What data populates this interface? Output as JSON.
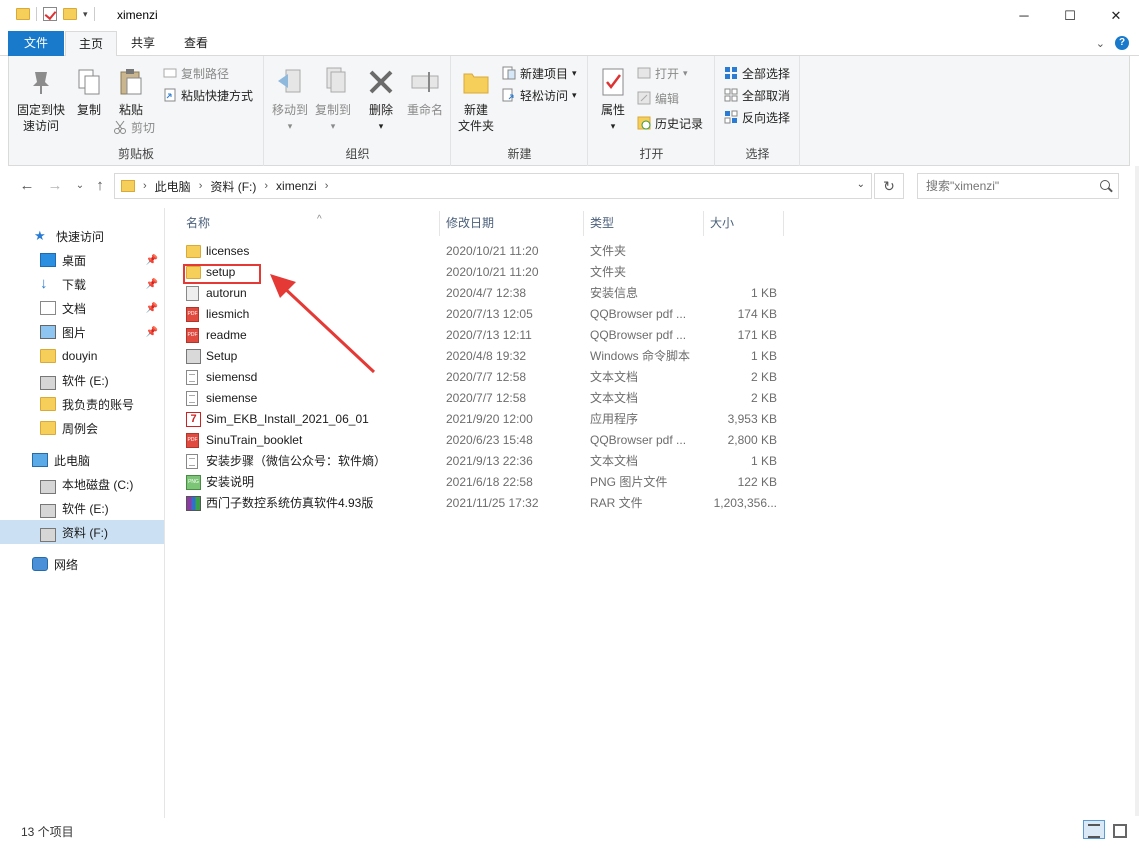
{
  "window": {
    "title": "ximenzi",
    "minimize": "─",
    "maximize": "☐",
    "close": "✕"
  },
  "ribbon_tabs": {
    "file": "文件",
    "home": "主页",
    "share": "共享",
    "view": "查看"
  },
  "ribbon": {
    "clipboard": {
      "label": "剪贴板",
      "pin": "固定到快速访问",
      "pin_line1": "固定到快",
      "pin_line2": "速访问",
      "copy": "复制",
      "paste": "粘贴",
      "copy_path": "复制路径",
      "paste_shortcut": "粘贴快捷方式",
      "cut": "剪切"
    },
    "organize": {
      "label": "组织",
      "move_to": "移动到",
      "copy_to": "复制到",
      "delete": "删除",
      "rename": "重命名"
    },
    "new": {
      "label": "新建",
      "new_folder_line1": "新建",
      "new_folder_line2": "文件夹",
      "new_item": "新建项目",
      "easy_access": "轻松访问"
    },
    "open": {
      "label": "打开",
      "properties": "属性",
      "open": "打开",
      "edit": "编辑",
      "history": "历史记录"
    },
    "select": {
      "label": "选择",
      "select_all": "全部选择",
      "select_none": "全部取消",
      "invert": "反向选择"
    }
  },
  "address": {
    "crumbs": [
      "此电脑",
      "资料 (F:)",
      "ximenzi"
    ],
    "search_placeholder": "搜索\"ximenzi\""
  },
  "nav_pane": {
    "items": [
      {
        "label": "快速访问",
        "icon": "star-icon",
        "pinned": false
      },
      {
        "label": "桌面",
        "icon": "desktop-icon",
        "pinned": true
      },
      {
        "label": "下载",
        "icon": "download-icon",
        "pinned": true
      },
      {
        "label": "文档",
        "icon": "document-icon",
        "pinned": true
      },
      {
        "label": "图片",
        "icon": "picture-icon",
        "pinned": true
      },
      {
        "label": "douyin",
        "icon": "folder-icon",
        "pinned": false
      },
      {
        "label": "软件 (E:)",
        "icon": "drive-icon",
        "pinned": false
      },
      {
        "label": "我负责的账号",
        "icon": "folder-icon",
        "pinned": false
      },
      {
        "label": "周例会",
        "icon": "folder-icon",
        "pinned": false
      },
      {
        "label": "此电脑",
        "icon": "pc-icon",
        "pinned": false
      },
      {
        "label": "本地磁盘 (C:)",
        "icon": "drive-icon",
        "pinned": false
      },
      {
        "label": "软件 (E:)",
        "icon": "drive-icon",
        "pinned": false
      },
      {
        "label": "资料 (F:)",
        "icon": "drive-icon",
        "pinned": false,
        "selected": true
      },
      {
        "label": "网络",
        "icon": "network-icon",
        "pinned": false
      }
    ]
  },
  "columns": {
    "name": "名称",
    "date": "修改日期",
    "type": "类型",
    "size": "大小"
  },
  "files": [
    {
      "name": "licenses",
      "date": "2020/10/21 11:20",
      "type": "文件夹",
      "size": "",
      "icon": "folder"
    },
    {
      "name": "setup",
      "date": "2020/10/21 11:20",
      "type": "文件夹",
      "size": "",
      "icon": "folder"
    },
    {
      "name": "autorun",
      "date": "2020/4/7 12:38",
      "type": "安装信息",
      "size": "1 KB",
      "icon": "inf"
    },
    {
      "name": "liesmich",
      "date": "2020/7/13 12:05",
      "type": "QQBrowser pdf ...",
      "size": "174 KB",
      "icon": "pdf"
    },
    {
      "name": "readme",
      "date": "2020/7/13 12:11",
      "type": "QQBrowser pdf ...",
      "size": "171 KB",
      "icon": "pdf"
    },
    {
      "name": "Setup",
      "date": "2020/4/8 19:32",
      "type": "Windows 命令脚本",
      "size": "1 KB",
      "icon": "cmd"
    },
    {
      "name": "siemensd",
      "date": "2020/7/7 12:58",
      "type": "文本文档",
      "size": "2 KB",
      "icon": "txt"
    },
    {
      "name": "siemense",
      "date": "2020/7/7 12:58",
      "type": "文本文档",
      "size": "2 KB",
      "icon": "txt"
    },
    {
      "name": "Sim_EKB_Install_2021_06_01",
      "date": "2021/9/20 12:00",
      "type": "应用程序",
      "size": "3,953 KB",
      "icon": "exe"
    },
    {
      "name": "SinuTrain_booklet",
      "date": "2020/6/23 15:48",
      "type": "QQBrowser pdf ...",
      "size": "2,800 KB",
      "icon": "pdf"
    },
    {
      "name": "安装步骤（微信公众号：软件熵）",
      "date": "2021/9/13 22:36",
      "type": "文本文档",
      "size": "1 KB",
      "icon": "txt"
    },
    {
      "name": "安装说明",
      "date": "2021/6/18 22:58",
      "type": "PNG 图片文件",
      "size": "122 KB",
      "icon": "png"
    },
    {
      "name": "西门子数控系统仿真软件4.93版",
      "date": "2021/11/25 17:32",
      "type": "RAR 文件",
      "size": "1,203,356...",
      "icon": "rar"
    }
  ],
  "status": {
    "count": "13 个项目"
  },
  "colors": {
    "accent": "#1979ca",
    "selection": "#cce0f3",
    "annotation": "#e53935"
  }
}
